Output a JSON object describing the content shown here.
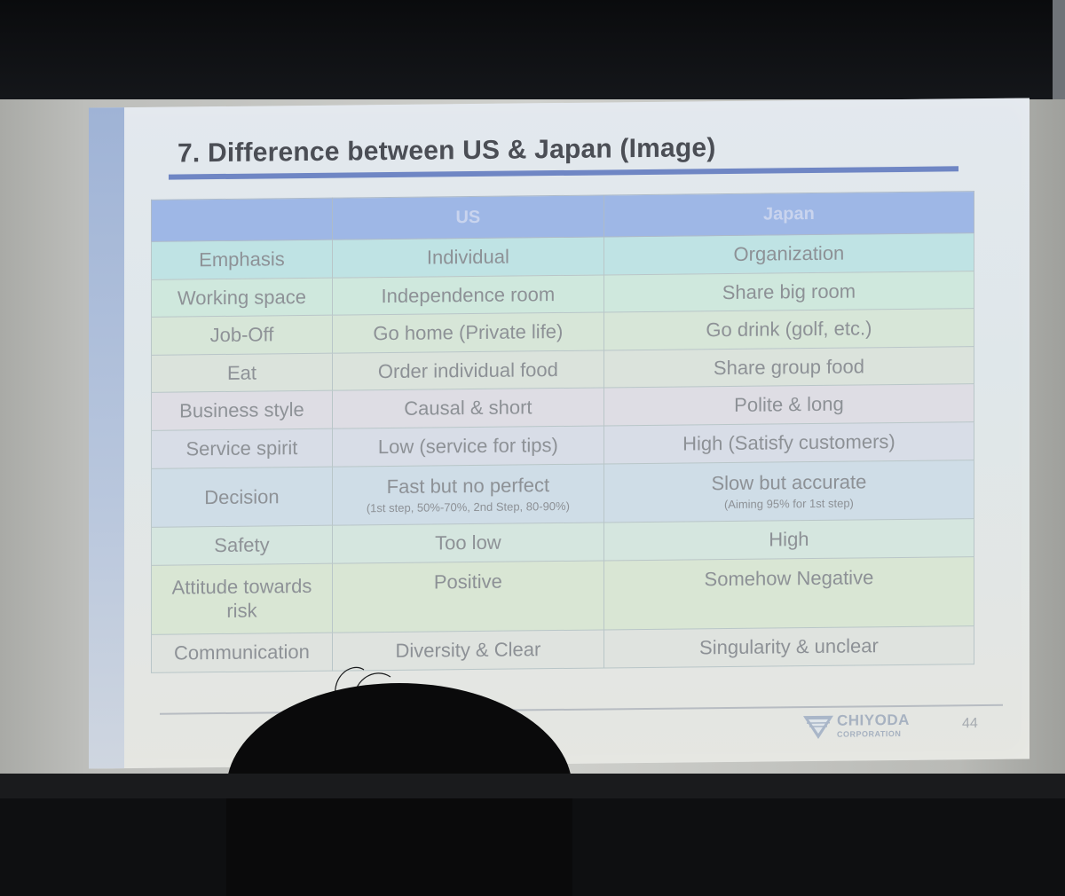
{
  "slide": {
    "title": "7. Difference between US & Japan (Image)",
    "page_number": "44",
    "logo": {
      "name": "CHIYODA",
      "sub": "CORPORATION"
    }
  },
  "table": {
    "headers": [
      "",
      "US",
      "Japan"
    ],
    "rows": [
      {
        "label": "Emphasis",
        "us": "Individual",
        "japan": "Organization"
      },
      {
        "label": "Working space",
        "us": "Independence room",
        "japan": "Share big room"
      },
      {
        "label": "Job-Off",
        "us": "Go home (Private life)",
        "japan": "Go drink (golf, etc.)"
      },
      {
        "label": "Eat",
        "us": "Order individual food",
        "japan": "Share group food"
      },
      {
        "label": "Business style",
        "us": "Causal & short",
        "japan": "Polite & long"
      },
      {
        "label": "Service spirit",
        "us": "Low (service for tips)",
        "japan": "High (Satisfy customers)"
      },
      {
        "label": "Decision",
        "us": "Fast but no perfect",
        "us_note": "(1st step, 50%-70%, 2nd Step, 80-90%)",
        "japan": "Slow but accurate",
        "japan_note": "(Aiming 95% for 1st step)"
      },
      {
        "label": "Safety",
        "us": "Too low",
        "japan": "High"
      },
      {
        "label": "Attitude towards risk",
        "us": "Positive",
        "japan": "Somehow Negative"
      },
      {
        "label": "Communication",
        "us": "Diversity & Clear",
        "japan": "Singularity & unclear"
      }
    ]
  }
}
